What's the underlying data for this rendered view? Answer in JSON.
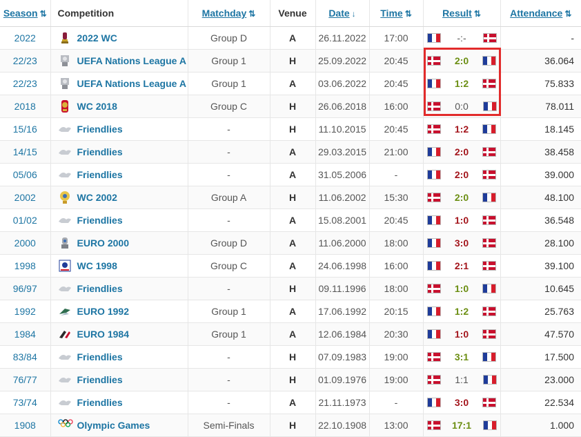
{
  "headers": {
    "season": "Season",
    "competition": "Competition",
    "matchday": "Matchday",
    "venue": "Venue",
    "date": "Date",
    "time": "Time",
    "result": "Result",
    "attendance": "Attendance"
  },
  "rows": [
    {
      "season": "2022",
      "competition": "2022 WC",
      "icon": "wc-trophy-icon",
      "matchday": "Group D",
      "venue": "A",
      "date": "26.11.2022",
      "time": "17:00",
      "home": "fr",
      "score": "-:-",
      "away": "dk",
      "score_color": "grey",
      "attendance": "-"
    },
    {
      "season": "22/23",
      "competition": "UEFA Nations League A",
      "icon": "nations-league-icon",
      "matchday": "Group 1",
      "venue": "H",
      "date": "25.09.2022",
      "time": "20:45",
      "home": "dk",
      "score": "2:0",
      "away": "fr",
      "score_color": "green",
      "attendance": "36.064"
    },
    {
      "season": "22/23",
      "competition": "UEFA Nations League A",
      "icon": "nations-league-icon",
      "matchday": "Group 1",
      "venue": "A",
      "date": "03.06.2022",
      "time": "20:45",
      "home": "fr",
      "score": "1:2",
      "away": "dk",
      "score_color": "green",
      "attendance": "75.833"
    },
    {
      "season": "2018",
      "competition": "WC 2018",
      "icon": "wc-2018-icon",
      "matchday": "Group C",
      "venue": "H",
      "date": "26.06.2018",
      "time": "16:00",
      "home": "dk",
      "score": "0:0",
      "away": "fr",
      "score_color": "grey",
      "attendance": "78.011"
    },
    {
      "season": "15/16",
      "competition": "Friendlies",
      "icon": "friendlies-icon",
      "matchday": "-",
      "venue": "H",
      "date": "11.10.2015",
      "time": "20:45",
      "home": "dk",
      "score": "1:2",
      "away": "fr",
      "score_color": "red",
      "attendance": "18.145"
    },
    {
      "season": "14/15",
      "competition": "Friendlies",
      "icon": "friendlies-icon",
      "matchday": "-",
      "venue": "A",
      "date": "29.03.2015",
      "time": "21:00",
      "home": "fr",
      "score": "2:0",
      "away": "dk",
      "score_color": "red",
      "attendance": "38.458"
    },
    {
      "season": "05/06",
      "competition": "Friendlies",
      "icon": "friendlies-icon",
      "matchday": "-",
      "venue": "A",
      "date": "31.05.2006",
      "time": "-",
      "home": "fr",
      "score": "2:0",
      "away": "dk",
      "score_color": "red",
      "attendance": "39.000"
    },
    {
      "season": "2002",
      "competition": "WC 2002",
      "icon": "wc-2002-icon",
      "matchday": "Group A",
      "venue": "H",
      "date": "11.06.2002",
      "time": "15:30",
      "home": "dk",
      "score": "2:0",
      "away": "fr",
      "score_color": "green",
      "attendance": "48.100"
    },
    {
      "season": "01/02",
      "competition": "Friendlies",
      "icon": "friendlies-icon",
      "matchday": "-",
      "venue": "A",
      "date": "15.08.2001",
      "time": "20:45",
      "home": "fr",
      "score": "1:0",
      "away": "dk",
      "score_color": "red",
      "attendance": "36.548"
    },
    {
      "season": "2000",
      "competition": "EURO 2000",
      "icon": "euro-2000-icon",
      "matchday": "Group D",
      "venue": "A",
      "date": "11.06.2000",
      "time": "18:00",
      "home": "fr",
      "score": "3:0",
      "away": "dk",
      "score_color": "red",
      "attendance": "28.100"
    },
    {
      "season": "1998",
      "competition": "WC 1998",
      "icon": "wc-1998-icon",
      "matchday": "Group C",
      "venue": "A",
      "date": "24.06.1998",
      "time": "16:00",
      "home": "fr",
      "score": "2:1",
      "away": "dk",
      "score_color": "red",
      "attendance": "39.100"
    },
    {
      "season": "96/97",
      "competition": "Friendlies",
      "icon": "friendlies-icon",
      "matchday": "-",
      "venue": "H",
      "date": "09.11.1996",
      "time": "18:00",
      "home": "dk",
      "score": "1:0",
      "away": "fr",
      "score_color": "green",
      "attendance": "10.645"
    },
    {
      "season": "1992",
      "competition": "EURO 1992",
      "icon": "euro-1992-icon",
      "matchday": "Group 1",
      "venue": "A",
      "date": "17.06.1992",
      "time": "20:15",
      "home": "fr",
      "score": "1:2",
      "away": "dk",
      "score_color": "green",
      "attendance": "25.763"
    },
    {
      "season": "1984",
      "competition": "EURO 1984",
      "icon": "euro-1984-icon",
      "matchday": "Group 1",
      "venue": "A",
      "date": "12.06.1984",
      "time": "20:30",
      "home": "fr",
      "score": "1:0",
      "away": "dk",
      "score_color": "red",
      "attendance": "47.570"
    },
    {
      "season": "83/84",
      "competition": "Friendlies",
      "icon": "friendlies-icon",
      "matchday": "-",
      "venue": "H",
      "date": "07.09.1983",
      "time": "19:00",
      "home": "dk",
      "score": "3:1",
      "away": "fr",
      "score_color": "green",
      "attendance": "17.500"
    },
    {
      "season": "76/77",
      "competition": "Friendlies",
      "icon": "friendlies-icon",
      "matchday": "-",
      "venue": "H",
      "date": "01.09.1976",
      "time": "19:00",
      "home": "dk",
      "score": "1:1",
      "away": "fr",
      "score_color": "grey",
      "attendance": "23.000"
    },
    {
      "season": "73/74",
      "competition": "Friendlies",
      "icon": "friendlies-icon",
      "matchday": "-",
      "venue": "A",
      "date": "21.11.1973",
      "time": "-",
      "home": "fr",
      "score": "3:0",
      "away": "dk",
      "score_color": "red",
      "attendance": "22.534"
    },
    {
      "season": "1908",
      "competition": "Olympic Games",
      "icon": "olympic-rings-icon",
      "matchday": "Semi-Finals",
      "venue": "H",
      "date": "22.10.1908",
      "time": "13:00",
      "home": "dk",
      "score": "17:1",
      "away": "fr",
      "score_color": "green",
      "attendance": "1.000"
    }
  ],
  "colors": {
    "link": "#1d75a3",
    "win": "#6b8e12",
    "loss": "#a3141b",
    "highlight": "#e22b2b"
  }
}
